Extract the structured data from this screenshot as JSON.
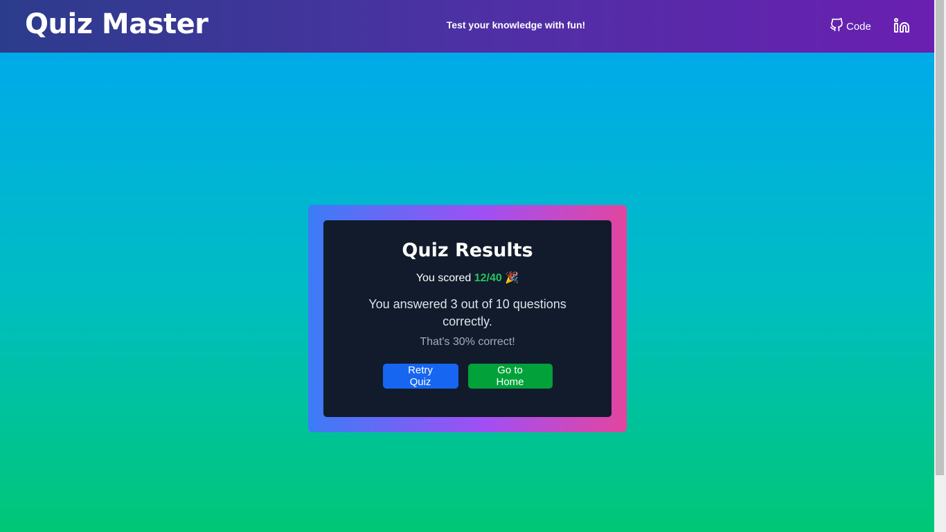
{
  "header": {
    "logo": "Quiz Master",
    "tagline": "Test your knowledge with fun!",
    "code_label": "Code",
    "github_icon": "github-icon",
    "linkedin_icon": "linkedin-icon"
  },
  "results": {
    "title": "Quiz Results",
    "score_prefix": "You scored",
    "score": "12/40",
    "party_icon": "🎉",
    "answered_text": "You answered 3 out of 10 questions correctly.",
    "percent_text": "That's 30% correct!",
    "retry_label": "Retry Quiz",
    "home_label": "Go to Home"
  },
  "colors": {
    "score_green": "#22c55e",
    "retry_blue": "#1766f2",
    "home_green": "#03a13a",
    "card_bg": "#111b2b"
  }
}
